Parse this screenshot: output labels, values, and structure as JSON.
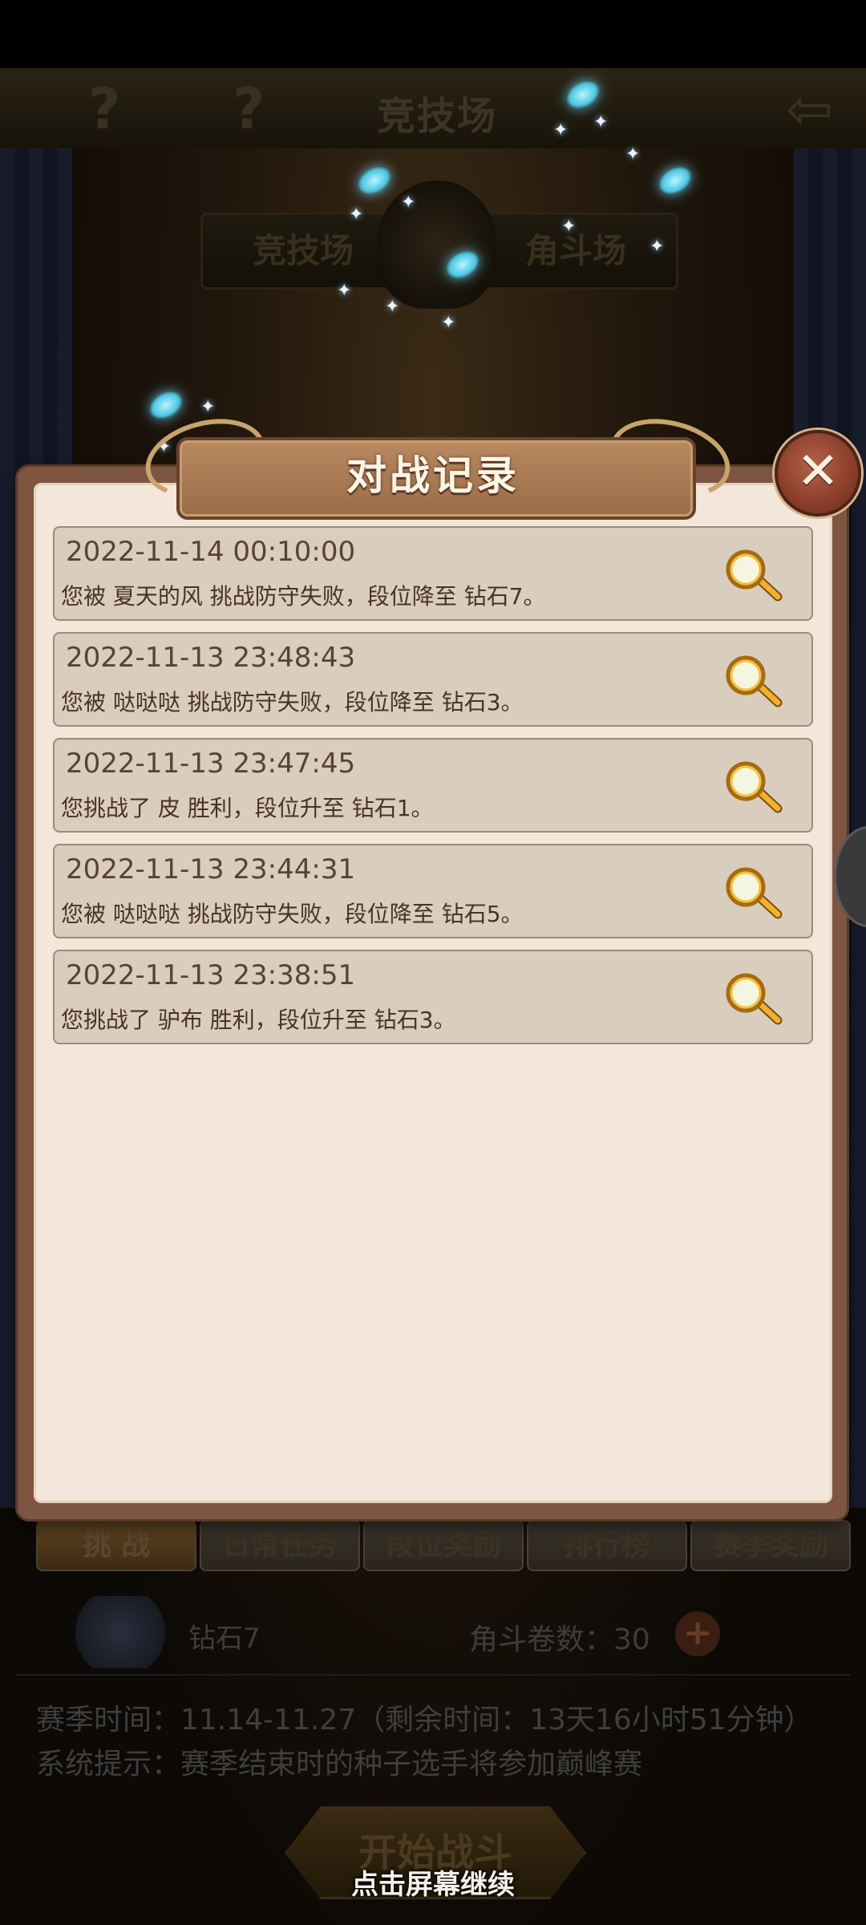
{
  "background": {
    "top_title": "竞技场",
    "mode_tabs": [
      "竞技场",
      "角斗场"
    ],
    "bottom_tabs": [
      "挑 战",
      "日常任务",
      "段位奖励",
      "排行榜",
      "赛季奖励"
    ],
    "rank_name": "钻石7",
    "horn_label": "角斗卷数：30",
    "season_time": "赛季时间：11.14-11.27（剩余时间：13天16小时51分钟）",
    "system_hint": "系统提示：赛季结束时的种子选手将参加巅峰赛",
    "start_button": "开始战斗"
  },
  "dialog": {
    "title": "对战记录",
    "records": [
      {
        "time": "2022-11-14 00:10:00",
        "desc": "您被 夏天的风 挑战防守失败，段位降至 钻石7。"
      },
      {
        "time": "2022-11-13 23:48:43",
        "desc": "您被 哒哒哒 挑战防守失败，段位降至 钻石3。"
      },
      {
        "time": "2022-11-13 23:47:45",
        "desc": "您挑战了 皮 胜利，段位升至 钻石1。"
      },
      {
        "time": "2022-11-13 23:44:31",
        "desc": "您被 哒哒哒 挑战防守失败，段位降至 钻石5。"
      },
      {
        "time": "2022-11-13 23:38:51",
        "desc": "您挑战了 驴布 胜利，段位升至 钻石3。"
      }
    ]
  },
  "continue_hint": "点击屏幕继续",
  "icons": {
    "close": "close-icon",
    "record_view": "magnifier-icon",
    "help": "help-icon",
    "back": "back-arrow-icon"
  }
}
